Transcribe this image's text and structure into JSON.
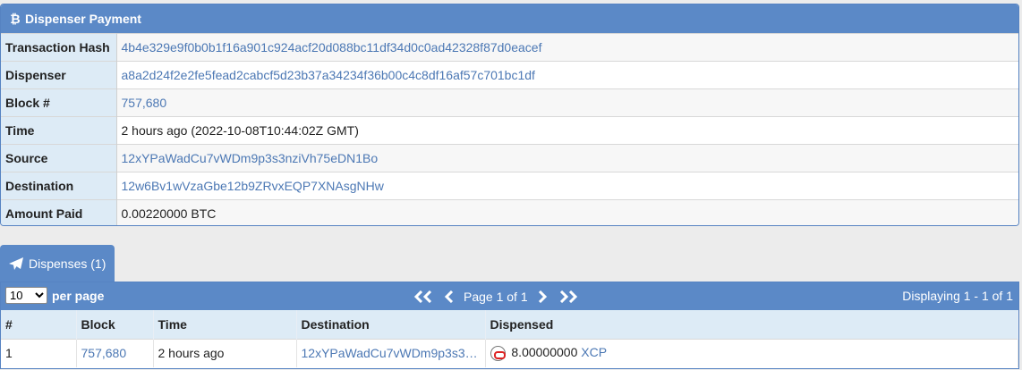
{
  "panel": {
    "title": "Dispenser Payment",
    "rows": [
      {
        "label": "Transaction Hash",
        "value": "4b4e329e9f0b0b1f16a901c924acf20d088bc11df34d0c0ad42328f87d0eacef",
        "link": true
      },
      {
        "label": "Dispenser",
        "value": "a8a2d24f2e2fe5fead2cabcf5d23b37a34234f36b00c4c8df16af57c701bc1df",
        "link": true
      },
      {
        "label": "Block #",
        "value": "757,680",
        "link": true
      },
      {
        "label": "Time",
        "value": "2 hours ago (2022-10-08T10:44:02Z GMT)",
        "link": false
      },
      {
        "label": "Source",
        "value": "12xYPaWadCu7vWDm9p3s3nziVh75eDN1Bo",
        "link": true
      },
      {
        "label": "Destination",
        "value": "12w6Bv1wVzaGbe12b9ZRvxEQP7XNAsgNHw",
        "link": true
      },
      {
        "label": "Amount Paid",
        "value": "0.00220000 BTC",
        "link": false
      }
    ]
  },
  "tab": {
    "label": "Dispenses (1)"
  },
  "pager": {
    "per_page_value": "10",
    "per_page_label": "per page",
    "page_text": "Page 1 of 1",
    "displaying": "Displaying 1 - 1 of 1"
  },
  "list": {
    "headers": [
      "#",
      "Block",
      "Time",
      "Destination",
      "Dispensed"
    ],
    "rows": [
      {
        "num": "1",
        "block": "757,680",
        "time": "2 hours ago",
        "destination": "12xYPaWadCu7vWDm9p3s3…",
        "amount": "8.00000000",
        "asset": "XCP"
      }
    ]
  },
  "colors": {
    "header_blue": "#5b89c7",
    "label_bg": "#ddebf6",
    "link": "#4c78b4"
  }
}
